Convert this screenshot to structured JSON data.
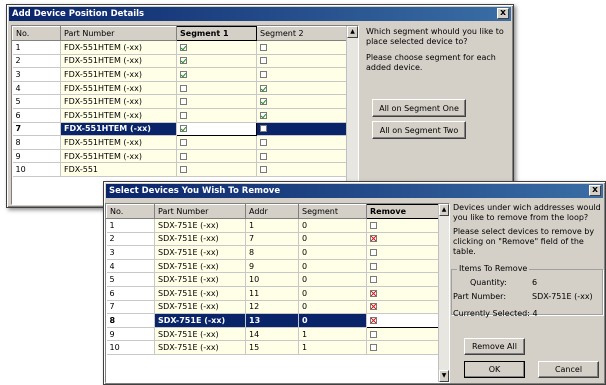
{
  "dialog1": {
    "title": "Add Device Position Details",
    "close_label": "x",
    "columns": [
      "No.",
      "Part Number",
      "Segment 1",
      "Segment 2"
    ],
    "rows": [
      {
        "no": "1",
        "part": "FDX-551HTEM (-xx)",
        "seg1": true,
        "seg2": false
      },
      {
        "no": "2",
        "part": "FDX-551HTEM (-xx)",
        "seg1": true,
        "seg2": false
      },
      {
        "no": "3",
        "part": "FDX-551HTEM (-xx)",
        "seg1": true,
        "seg2": false
      },
      {
        "no": "4",
        "part": "FDX-551HTEM (-xx)",
        "seg1": false,
        "seg2": true
      },
      {
        "no": "5",
        "part": "FDX-551HTEM (-xx)",
        "seg1": false,
        "seg2": true
      },
      {
        "no": "6",
        "part": "FDX-551HTEM (-xx)",
        "seg1": false,
        "seg2": true
      },
      {
        "no": "7",
        "part": "FDX-551HTEM (-xx)",
        "seg1": true,
        "seg2": false,
        "selected": true
      },
      {
        "no": "8",
        "part": "FDX-551HTEM (-xx)",
        "seg1": false,
        "seg2": false
      },
      {
        "no": "9",
        "part": "FDX-551HTEM (-xx)",
        "seg1": false,
        "seg2": false
      },
      {
        "no": "10",
        "part": "FDX-551",
        "seg1": false,
        "seg2": false
      }
    ],
    "question": "Which segment whould you like to place selected device to?",
    "instruction": "Please choose segment for each added device.",
    "btn_seg1": "All on Segment One",
    "btn_seg2": "All on Segment Two"
  },
  "dialog2": {
    "title": "Select Devices You Wish To Remove",
    "close_label": "x",
    "columns": [
      "No.",
      "Part Number",
      "Addr",
      "Segment",
      "Remove"
    ],
    "rows": [
      {
        "no": "1",
        "part": "SDX-751E (-xx)",
        "addr": "1",
        "segment": "0",
        "remove": false
      },
      {
        "no": "2",
        "part": "SDX-751E (-xx)",
        "addr": "7",
        "segment": "0",
        "remove": true
      },
      {
        "no": "3",
        "part": "SDX-751E (-xx)",
        "addr": "8",
        "segment": "0",
        "remove": false
      },
      {
        "no": "4",
        "part": "SDX-751E (-xx)",
        "addr": "9",
        "segment": "0",
        "remove": false
      },
      {
        "no": "5",
        "part": "SDX-751E (-xx)",
        "addr": "10",
        "segment": "0",
        "remove": false
      },
      {
        "no": "6",
        "part": "SDX-751E (-xx)",
        "addr": "11",
        "segment": "0",
        "remove": true
      },
      {
        "no": "7",
        "part": "SDX-751E (-xx)",
        "addr": "12",
        "segment": "0",
        "remove": true
      },
      {
        "no": "8",
        "part": "SDX-751E (-xx)",
        "addr": "13",
        "segment": "0",
        "remove": true,
        "selected": true
      },
      {
        "no": "9",
        "part": "SDX-751E (-xx)",
        "addr": "14",
        "segment": "1",
        "remove": false
      },
      {
        "no": "10",
        "part": "SDX-751E (-xx)",
        "addr": "15",
        "segment": "1",
        "remove": false
      }
    ],
    "question": "Devices under wich addresses would you like to remove from the loop?",
    "instruction": "Please select devices to remove by clicking on \"Remove\" field of the table.",
    "group_title": "Items To Remove",
    "quantity_label": "Quantity:",
    "quantity_value": "6",
    "part_label": "Part Number:",
    "part_value": "SDX-751E (-xx)",
    "selected_text": "Currently Selected: 4",
    "btn_remove_all": "Remove All",
    "btn_ok": "OK",
    "btn_cancel": "Cancel"
  }
}
